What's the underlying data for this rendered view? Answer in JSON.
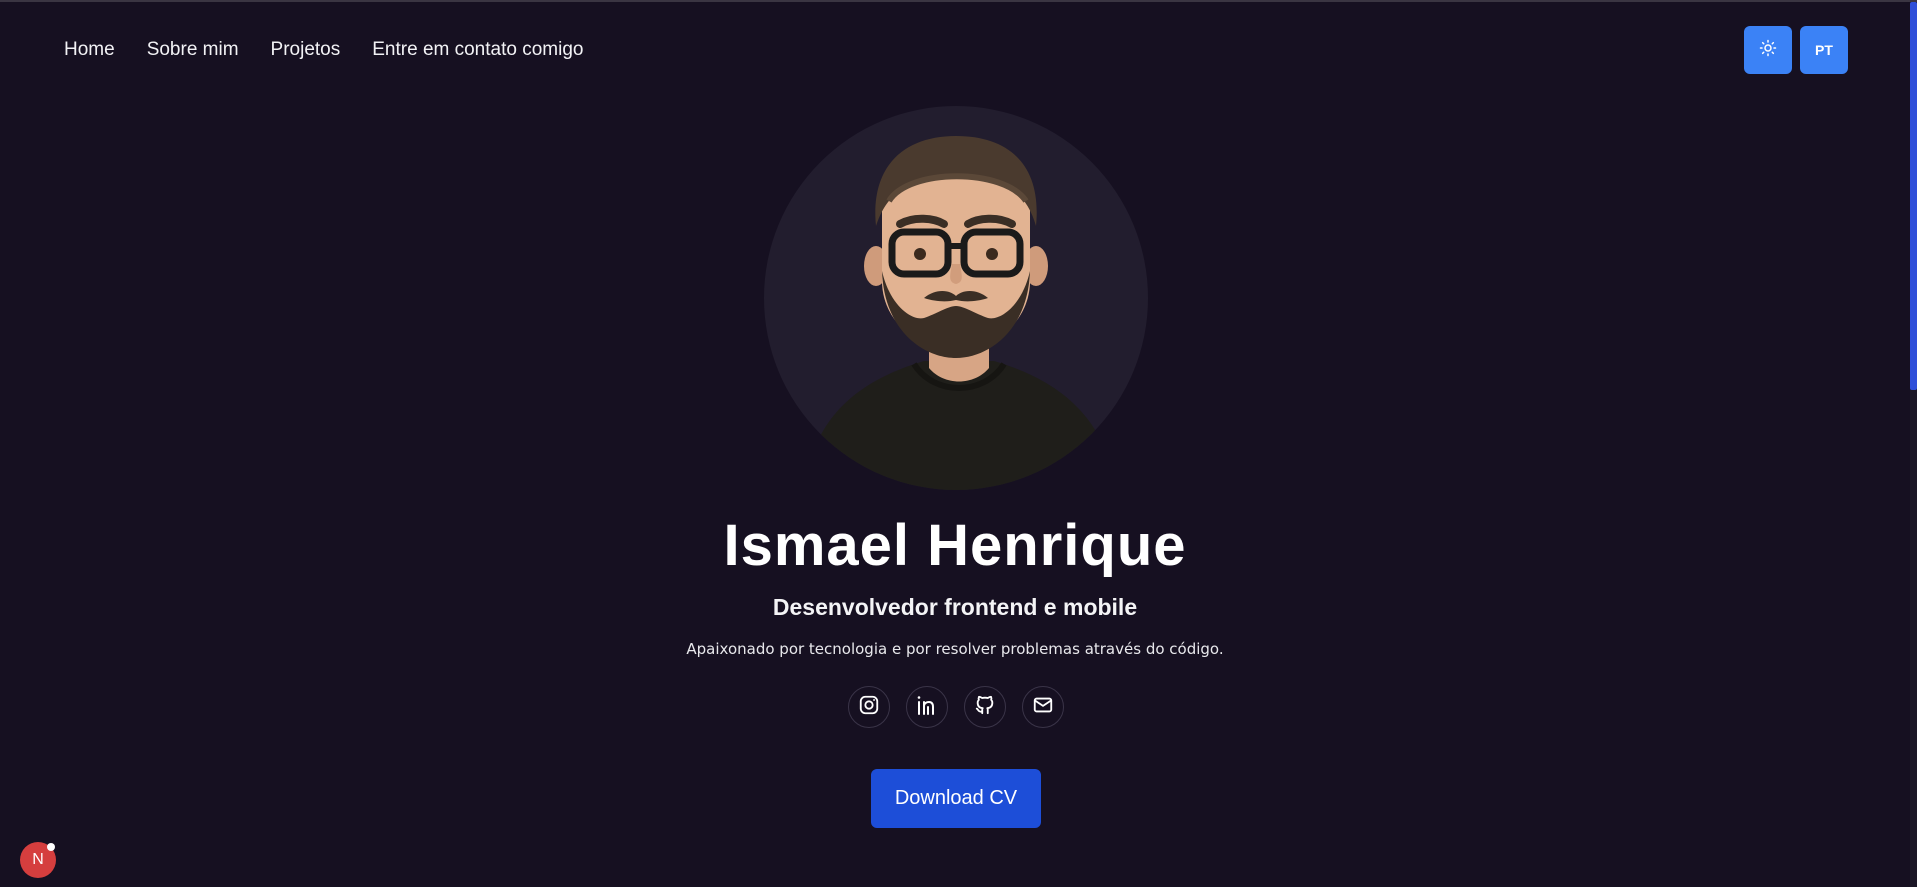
{
  "nav": {
    "items": [
      {
        "label": "Home"
      },
      {
        "label": "Sobre mim"
      },
      {
        "label": "Projetos"
      },
      {
        "label": "Entre em contato comigo"
      }
    ]
  },
  "controls": {
    "theme_icon": "sun-icon",
    "language_label": "PT"
  },
  "hero": {
    "avatar_icon": "avatar-illustration",
    "name": "Ismael Henrique",
    "role": "Desenvolvedor frontend e mobile",
    "tagline": "Apaixonado por tecnologia e por resolver problemas através do código.",
    "socials": [
      {
        "icon": "instagram-icon"
      },
      {
        "icon": "linkedin-icon"
      },
      {
        "icon": "github-icon"
      },
      {
        "icon": "mail-icon"
      }
    ],
    "cta_label": "Download CV"
  },
  "dev_indicator": {
    "label": "N"
  },
  "colors": {
    "background": "#161021",
    "accent": "#3b82f6",
    "cta": "#1d4ed8",
    "dev_badge": "#d53e3e"
  }
}
